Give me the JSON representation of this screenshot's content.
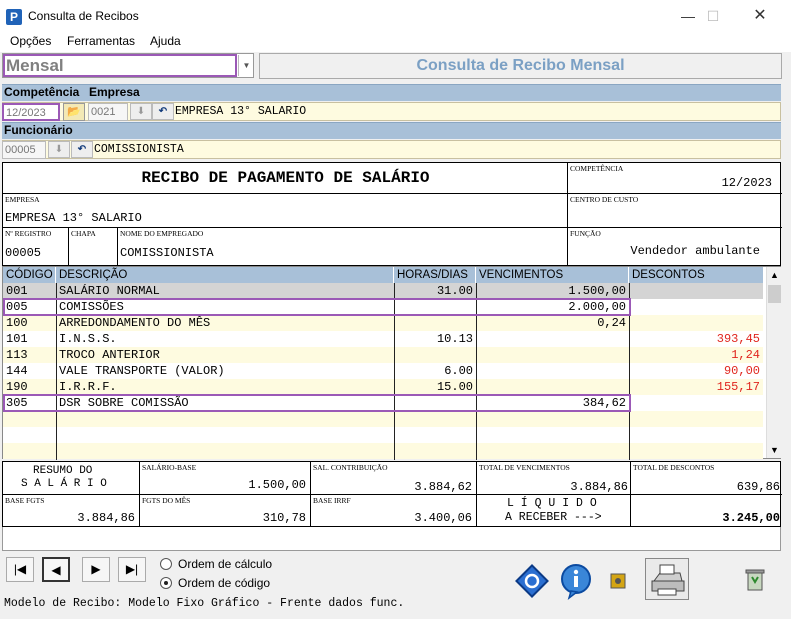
{
  "window": {
    "title": "Consulta de Recibos",
    "icon_letter": "P"
  },
  "menu": {
    "items": [
      "Opções",
      "Ferramentas",
      "Ajuda"
    ]
  },
  "mode": {
    "selected": "Mensal"
  },
  "page_title": "Consulta de Recibo Mensal",
  "competencia": {
    "label": "Competência",
    "value": "12/2023"
  },
  "empresa": {
    "label": "Empresa",
    "code": "0021",
    "name": "EMPRESA 13° SALARIO"
  },
  "funcionario": {
    "label": "Funcionário",
    "code": "00005",
    "name": "COMISSIONISTA"
  },
  "receipt": {
    "title": "RECIBO DE PAGAMENTO DE SALÁRIO",
    "competencia_label": "COMPETÊNCIA",
    "competencia_value": "12/2023",
    "empresa_label": "EMPRESA",
    "empresa_value": "EMPRESA 13° SALARIO",
    "centro_label": "CENTRO DE CUSTO",
    "registro_label": "Nº REGISTRO",
    "registro_value": "00005",
    "chapa_label": "CHAPA",
    "nome_label": "NOME DO EMPREGADO",
    "nome_value": "COMISSIONISTA",
    "funcao_label": "FUNÇÃO",
    "funcao_value": "Vendedor ambulante"
  },
  "grid": {
    "headers": [
      "CÓDIGO",
      "DESCRIÇÃO",
      "HORAS/DIAS",
      "VENCIMENTOS",
      "DESCONTOS"
    ],
    "rows": [
      {
        "code": "001",
        "desc": "SALÁRIO NORMAL",
        "hours": "31.00",
        "venc": "1.500,00",
        "desc_val": ""
      },
      {
        "code": "005",
        "desc": "COMISSÕES",
        "hours": "",
        "venc": "2.000,00",
        "desc_val": ""
      },
      {
        "code": "100",
        "desc": "ARREDONDAMENTO DO MÊS",
        "hours": "",
        "venc": "0,24",
        "desc_val": ""
      },
      {
        "code": "101",
        "desc": "I.N.S.S.",
        "hours": "10.13",
        "venc": "",
        "desc_val": "393,45"
      },
      {
        "code": "113",
        "desc": "TROCO ANTERIOR",
        "hours": "",
        "venc": "",
        "desc_val": "1,24"
      },
      {
        "code": "144",
        "desc": "VALE TRANSPORTE (VALOR)",
        "hours": "6.00",
        "venc": "",
        "desc_val": "90,00"
      },
      {
        "code": "190",
        "desc": "I.R.R.F.",
        "hours": "15.00",
        "venc": "",
        "desc_val": "155,17"
      },
      {
        "code": "305",
        "desc": "DSR SOBRE COMISSÃO",
        "hours": "",
        "venc": "384,62",
        "desc_val": ""
      }
    ]
  },
  "summary": {
    "resumo_line1": "RESUMO DO",
    "resumo_line2": "S A L Á R I O",
    "salario_base_label": "SALÁRIO-BASE",
    "salario_base": "1.500,00",
    "sal_contrib_label": "SAL. CONTRIBUIÇÃO",
    "sal_contrib": "3.884,62",
    "total_venc_label": "TOTAL DE VENCIMENTOS",
    "total_venc": "3.884,86",
    "total_desc_label": "TOTAL DE DESCONTOS",
    "total_desc": "639,86",
    "base_fgts_label": "BASE FGTS",
    "base_fgts": "3.884,86",
    "fgts_mes_label": "FGTS DO MÊS",
    "fgts_mes": "310,78",
    "base_irrf_label": "BASE IRRF",
    "base_irrf": "3.400,06",
    "liquido_line1": "L Í Q U I D O",
    "liquido_line2": "A RECEBER --->",
    "liquido": "3.245,00"
  },
  "ordering": {
    "option1": "Ordem de cálculo",
    "option2": "Ordem de código",
    "selected": "option2"
  },
  "status": "Modelo de Recibo: Modelo Fixo Gráfico - Frente dados func."
}
